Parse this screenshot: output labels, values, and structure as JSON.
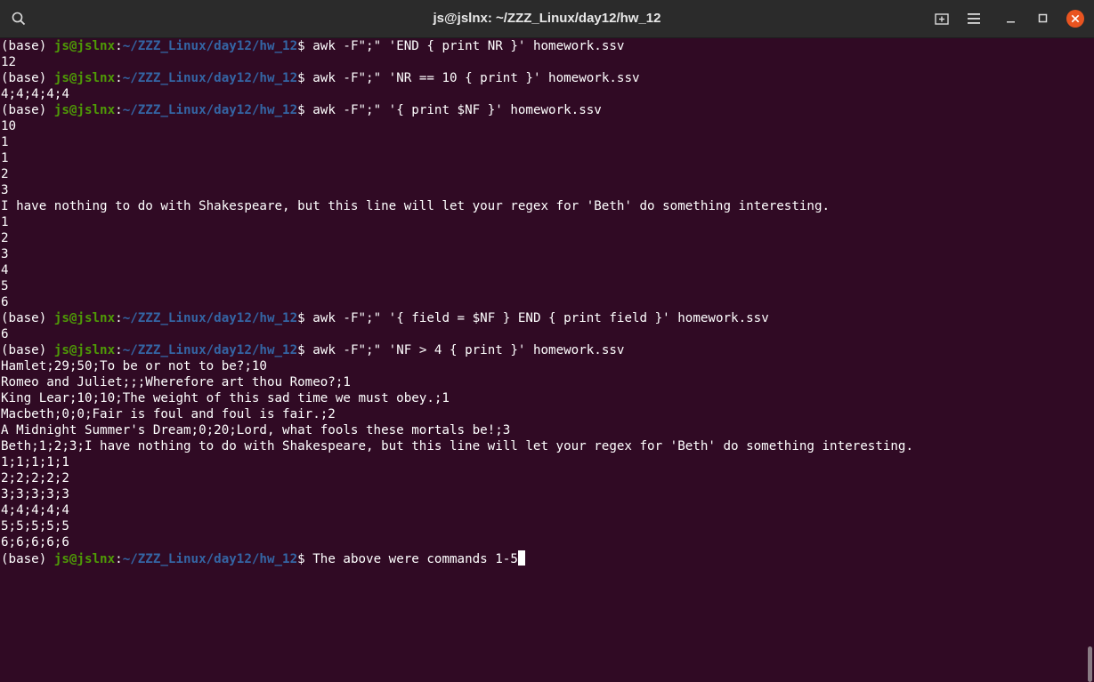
{
  "window": {
    "title": "js@jslnx: ~/ZZZ_Linux/day12/hw_12"
  },
  "icons": {
    "search": "search-icon",
    "new_tab": "new-tab-icon",
    "menu": "hamburger-menu-icon",
    "minimize": "minimize-icon",
    "maximize": "maximize-icon",
    "close": "close-icon"
  },
  "colors": {
    "background": "#300a24",
    "user_host": "#4e9a06",
    "path": "#3465a4",
    "text": "#ffffff",
    "close_button": "#e95420"
  },
  "prompt": {
    "env": "(base) ",
    "user_host": "js@jslnx",
    "sep": ":",
    "path": "~/ZZZ_Linux/day12/hw_12",
    "symbol": "$ "
  },
  "lines": [
    {
      "type": "cmd",
      "text": "awk -F\";\" 'END { print NR }' homework.ssv"
    },
    {
      "type": "out",
      "text": "12"
    },
    {
      "type": "cmd",
      "text": "awk -F\";\" 'NR == 10 { print }' homework.ssv"
    },
    {
      "type": "out",
      "text": "4;4;4;4;4"
    },
    {
      "type": "cmd",
      "text": "awk -F\";\" '{ print $NF }' homework.ssv"
    },
    {
      "type": "out",
      "text": "10"
    },
    {
      "type": "out",
      "text": "1"
    },
    {
      "type": "out",
      "text": "1"
    },
    {
      "type": "out",
      "text": "2"
    },
    {
      "type": "out",
      "text": "3"
    },
    {
      "type": "out",
      "text": "I have nothing to do with Shakespeare, but this line will let your regex for 'Beth' do something interesting."
    },
    {
      "type": "out",
      "text": "1"
    },
    {
      "type": "out",
      "text": "2"
    },
    {
      "type": "out",
      "text": "3"
    },
    {
      "type": "out",
      "text": "4"
    },
    {
      "type": "out",
      "text": "5"
    },
    {
      "type": "out",
      "text": "6"
    },
    {
      "type": "cmd",
      "text": "awk -F\";\" '{ field = $NF } END { print field }' homework.ssv"
    },
    {
      "type": "out",
      "text": "6"
    },
    {
      "type": "cmd",
      "text": "awk -F\";\" 'NF > 4 { print }' homework.ssv"
    },
    {
      "type": "out",
      "text": "Hamlet;29;50;To be or not to be?;10"
    },
    {
      "type": "out",
      "text": "Romeo and Juliet;;;Wherefore art thou Romeo?;1"
    },
    {
      "type": "out",
      "text": "King Lear;10;10;The weight of this sad time we must obey.;1"
    },
    {
      "type": "out",
      "text": "Macbeth;0;0;Fair is foul and foul is fair.;2"
    },
    {
      "type": "out",
      "text": "A Midnight Summer's Dream;0;20;Lord, what fools these mortals be!;3"
    },
    {
      "type": "out",
      "text": "Beth;1;2;3;I have nothing to do with Shakespeare, but this line will let your regex for 'Beth' do something interesting."
    },
    {
      "type": "out",
      "text": "1;1;1;1;1"
    },
    {
      "type": "out",
      "text": "2;2;2;2;2"
    },
    {
      "type": "out",
      "text": "3;3;3;3;3"
    },
    {
      "type": "out",
      "text": "4;4;4;4;4"
    },
    {
      "type": "out",
      "text": "5;5;5;5;5"
    },
    {
      "type": "out",
      "text": "6;6;6;6;6"
    },
    {
      "type": "cmd",
      "text": "The above were commands 1-5",
      "current": true
    }
  ]
}
